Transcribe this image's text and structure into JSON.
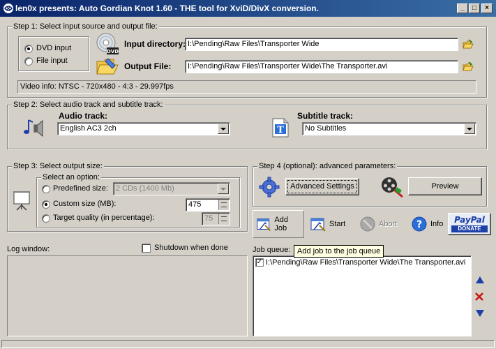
{
  "window": {
    "title": "len0x presents: Auto Gordian Knot 1.60 - THE tool for XviD/DivX conversion."
  },
  "step1": {
    "legend": "Step 1: Select input source and output file:",
    "dvd_input_label": "DVD input",
    "file_input_label": "File input",
    "selected": "DVD input",
    "dvd_badge": "DVD",
    "input_dir_label": "Input directory:",
    "input_dir_value": "I:\\Pending\\Raw Files\\Transporter Wide",
    "output_file_label": "Output File:",
    "output_file_value": "I:\\Pending\\Raw Files\\Transporter Wide\\The Transporter.avi",
    "video_info": "Video info:   NTSC - 720x480 - 4:3 - 29.997fps"
  },
  "step2": {
    "legend": "Step 2: Select audio track and subtitle track:",
    "audio_label": "Audio track:",
    "audio_value": "English AC3 2ch",
    "subtitle_label": "Subtitle track:",
    "subtitle_value": "No Subtitles"
  },
  "step3": {
    "legend": "Step 3: Select output size:",
    "option_legend": "Select an option:",
    "predefined_label": "Predefined size:",
    "predefined_value": "2 CDs (1400 Mb)",
    "custom_label": "Custom size (MB):",
    "custom_value": "475",
    "target_label": "Target quality (in percentage):",
    "target_value": "75",
    "selected": "Custom size (MB):"
  },
  "step4": {
    "legend": "Step 4 (optional): advanced parameters:",
    "advanced_label": "Advanced Settings",
    "preview_label": "Preview"
  },
  "toolbar": {
    "add_job": "Add Job",
    "start": "Start",
    "abort": "Abort",
    "info": "Info",
    "paypal_top": "PayPal",
    "paypal_bottom": "DONATE"
  },
  "log": {
    "label": "Log window:",
    "shutdown_label": "Shutdown when done",
    "shutdown_checked": false
  },
  "queue": {
    "label": "Job queue:",
    "tooltip": "Add job to the job queue",
    "items": [
      {
        "checked": true,
        "path": "I:\\Pending\\Raw Files\\Transporter Wide\\The Transporter.avi"
      }
    ]
  },
  "colors": {
    "title_start": "#0a246a",
    "title_end": "#3a6ea5",
    "face": "#d4d0c8",
    "tooltip_bg": "#ffffe1",
    "arrow_blue": "#1c3fa8",
    "remove_red": "#cc1111"
  },
  "icons": {
    "title": "gordian-knot-icon",
    "dvd": "dvd-disc-icon",
    "folder": "folder-icon",
    "audio": "music-note-speaker-icon",
    "subtitle": "subtitle-t-icon",
    "presentation": "presentation-board-icon",
    "gear": "gear-icon",
    "film": "film-reel-icon"
  }
}
